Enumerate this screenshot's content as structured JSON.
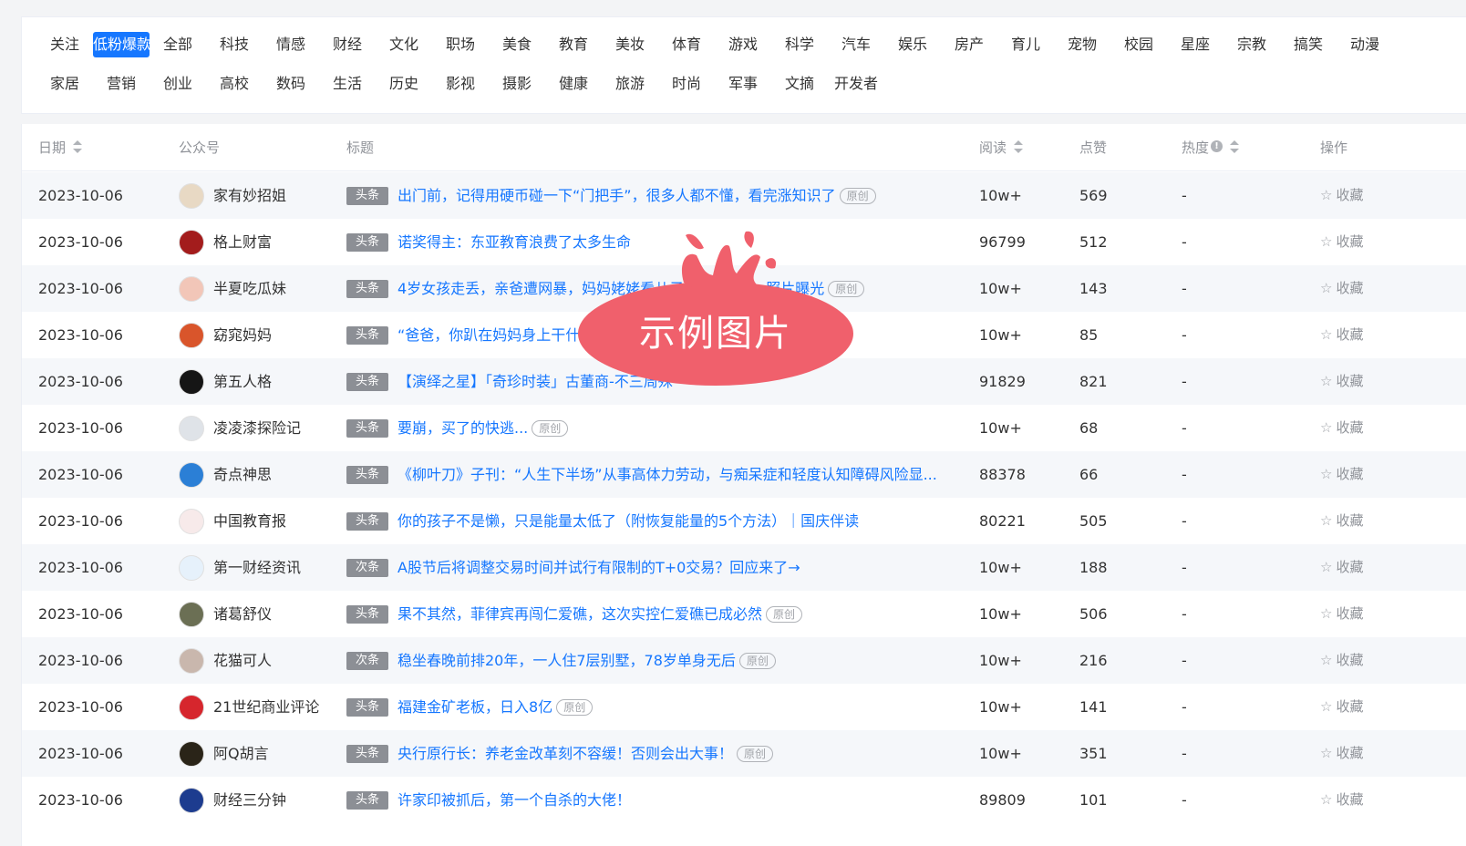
{
  "categories": {
    "row1": [
      "关注",
      "低粉爆款",
      "全部",
      "科技",
      "情感",
      "财经",
      "文化",
      "职场",
      "美食",
      "教育",
      "美妆",
      "体育",
      "游戏",
      "科学",
      "汽车",
      "娱乐",
      "房产",
      "育儿",
      "宠物",
      "校园",
      "星座",
      "宗教",
      "搞笑",
      "动漫"
    ],
    "row2": [
      "家居",
      "营销",
      "创业",
      "高校",
      "数码",
      "生活",
      "历史",
      "影视",
      "摄影",
      "健康",
      "旅游",
      "时尚",
      "军事",
      "文摘",
      "开发者"
    ],
    "active": "低粉爆款"
  },
  "table": {
    "headers": {
      "date": "日期",
      "account": "公众号",
      "title": "标题",
      "read": "阅读",
      "like": "点赞",
      "heat": "热度",
      "op": "操作"
    },
    "info_glyph": "!",
    "star_glyph": "☆",
    "original_label": "原创",
    "rows": [
      {
        "date": "2023-10-06",
        "account": "家有妙招姐",
        "tag": "头条",
        "title": "出门前，记得用硬币碰一下“门把手”，很多人都不懂，看完涨知识了",
        "original": true,
        "read": "10w+",
        "like": "569",
        "heat": "-",
        "op": "收藏",
        "avatar": "#e8d9c4"
      },
      {
        "date": "2023-10-06",
        "account": "格上财富",
        "tag": "头条",
        "title": "诺奖得主：东亚教育浪费了太多生命",
        "original": false,
        "read": "96799",
        "like": "512",
        "heat": "-",
        "op": "收藏",
        "avatar": "#a31c1c"
      },
      {
        "date": "2023-10-06",
        "account": "半夏吃瓜妹",
        "tag": "头条",
        "title": "4岁女孩走丢，亲爸遭网暴，妈妈姥姥看儿子",
        "title_tail": "照片曝光",
        "original": true,
        "read": "10w+",
        "like": "143",
        "heat": "-",
        "op": "收藏",
        "avatar": "#f2c6b8"
      },
      {
        "date": "2023-10-06",
        "account": "窈窕妈妈",
        "tag": "头条",
        "title": "“爸爸，你趴在妈妈身上干什",
        "original": false,
        "read": "10w+",
        "like": "85",
        "heat": "-",
        "op": "收藏",
        "avatar": "#d9552b"
      },
      {
        "date": "2023-10-06",
        "account": "第五人格",
        "tag": "头条",
        "title": "【演绎之星】「奇珍时装」古董商-不三周殊",
        "original": false,
        "read": "91829",
        "like": "821",
        "heat": "-",
        "op": "收藏",
        "avatar": "#151515"
      },
      {
        "date": "2023-10-06",
        "account": "凌凌漆探险记",
        "tag": "头条",
        "title": "要崩，买了的快逃...",
        "original": true,
        "read": "10w+",
        "like": "68",
        "heat": "-",
        "op": "收藏",
        "avatar": "#dfe3e8"
      },
      {
        "date": "2023-10-06",
        "account": "奇点神思",
        "tag": "头条",
        "title": "《柳叶刀》子刊：“人生下半场”从事高体力劳动，与痴呆症和轻度认知障碍风险显...",
        "original": false,
        "read": "88378",
        "like": "66",
        "heat": "-",
        "op": "收藏",
        "avatar": "#2b7fd6"
      },
      {
        "date": "2023-10-06",
        "account": "中国教育报",
        "tag": "头条",
        "title": "你的孩子不是懒，只是能量太低了（附恢复能量的5个方法）｜国庆伴读",
        "original": false,
        "read": "80221",
        "like": "505",
        "heat": "-",
        "op": "收藏",
        "avatar": "#f7eaea"
      },
      {
        "date": "2023-10-06",
        "account": "第一财经资讯",
        "tag": "次条",
        "title": "A股节后将调整交易时间并试行有限制的T+0交易？回应来了→",
        "original": false,
        "read": "10w+",
        "like": "188",
        "heat": "-",
        "op": "收藏",
        "avatar": "#e6f1fb"
      },
      {
        "date": "2023-10-06",
        "account": "诸葛舒仪",
        "tag": "头条",
        "title": "果不其然，菲律宾再闯仁爱礁，这次实控仁爱礁已成必然",
        "original": true,
        "read": "10w+",
        "like": "506",
        "heat": "-",
        "op": "收藏",
        "avatar": "#6b6f54"
      },
      {
        "date": "2023-10-06",
        "account": "花猫可人",
        "tag": "次条",
        "title": "稳坐春晚前排20年，一人住7层别墅，78岁单身无后",
        "original": true,
        "read": "10w+",
        "like": "216",
        "heat": "-",
        "op": "收藏",
        "avatar": "#c9b7ad"
      },
      {
        "date": "2023-10-06",
        "account": "21世纪商业评论",
        "tag": "头条",
        "title": "福建金矿老板，日入8亿",
        "original": true,
        "read": "10w+",
        "like": "141",
        "heat": "-",
        "op": "收藏",
        "avatar": "#d6262d"
      },
      {
        "date": "2023-10-06",
        "account": "阿Q胡言",
        "tag": "头条",
        "title": "央行原行长：养老金改革刻不容缓！否则会出大事！",
        "original": true,
        "read": "10w+",
        "like": "351",
        "heat": "-",
        "op": "收藏",
        "avatar": "#2a2418"
      },
      {
        "date": "2023-10-06",
        "account": "财经三分钟",
        "tag": "头条",
        "title": "许家印被抓后，第一个自杀的大佬！",
        "original": false,
        "read": "89809",
        "like": "101",
        "heat": "-",
        "op": "收藏",
        "avatar": "#1d3c8f"
      }
    ]
  },
  "watermark": {
    "text": "示例图片",
    "color": "#f0606c"
  }
}
